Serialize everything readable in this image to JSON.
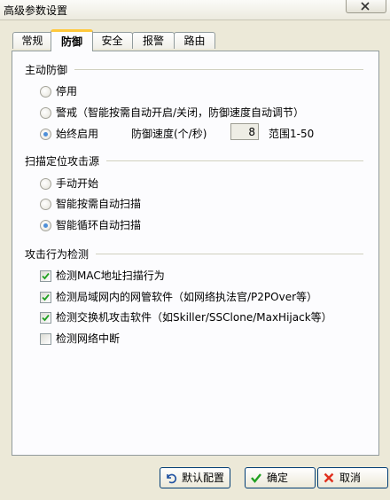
{
  "window": {
    "title": "高级参数设置"
  },
  "tabs": [
    {
      "label": "常规",
      "active": false
    },
    {
      "label": "防御",
      "active": true
    },
    {
      "label": "安全",
      "active": false
    },
    {
      "label": "报警",
      "active": false
    },
    {
      "label": "路由",
      "active": false
    }
  ],
  "active_defense": {
    "title": "主动防御",
    "options": [
      {
        "label": "停用",
        "selected": false
      },
      {
        "label": "警戒（智能按需自动开启/关闭，防御速度自动调节）",
        "selected": false
      },
      {
        "label": "始终启用",
        "selected": true
      }
    ],
    "speed_label": "防御速度(个/秒)",
    "speed_value": "8",
    "range_label": "范围1-50"
  },
  "scan_source": {
    "title": "扫描定位攻击源",
    "options": [
      {
        "label": "手动开始",
        "selected": false
      },
      {
        "label": "智能按需自动扫描",
        "selected": false
      },
      {
        "label": "智能循环自动扫描",
        "selected": true
      }
    ]
  },
  "attack_detection": {
    "title": "攻击行为检测",
    "options": [
      {
        "label": "检测MAC地址扫描行为",
        "checked": true
      },
      {
        "label": "检测局域网内的网管软件（如网络执法官/P2POver等）",
        "checked": true
      },
      {
        "label": "检测交换机攻击软件（如Skiller/SSClone/MaxHijack等）",
        "checked": true
      },
      {
        "label": "检测网络中断",
        "checked": false
      }
    ]
  },
  "buttons": {
    "default_label": "默认配置",
    "ok_label": "确定",
    "cancel_label": "取消"
  },
  "colors": {
    "tab_accent": "#ffc83c",
    "radio_dot": "#4e8fd8",
    "check_mark": "#21a121",
    "cancel_x": "#e0301e"
  }
}
